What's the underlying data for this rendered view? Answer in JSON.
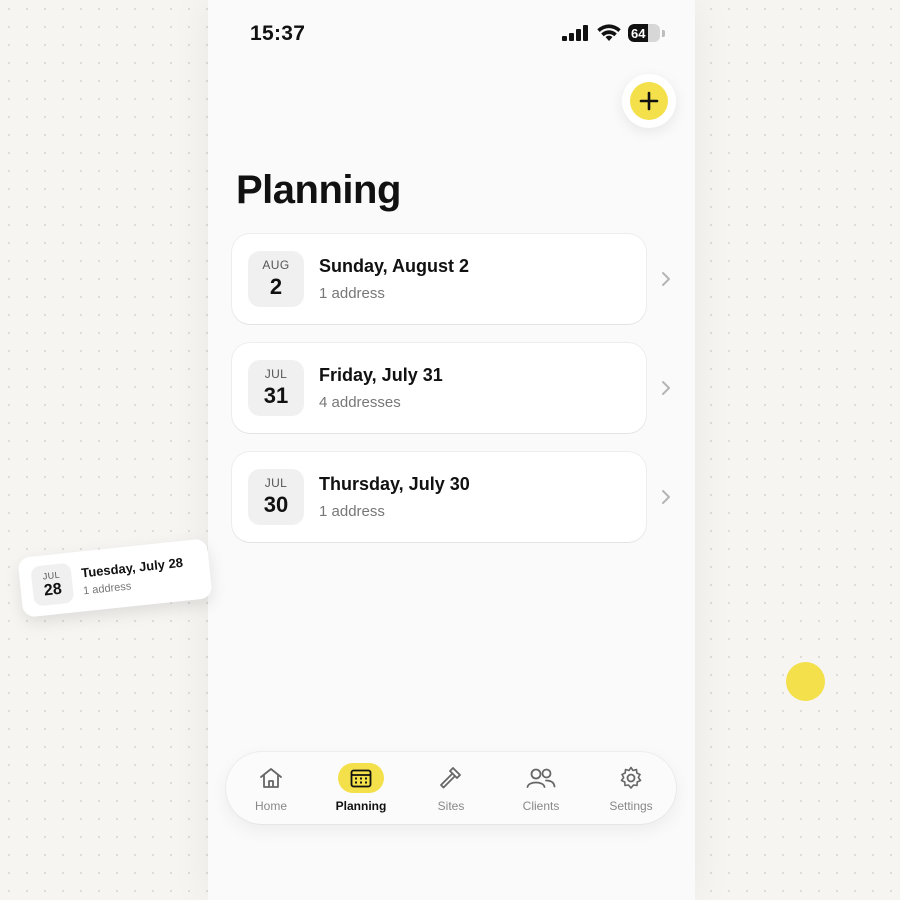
{
  "status_bar": {
    "time": "15:37",
    "battery_percent": 64,
    "battery_label": "64",
    "icons": [
      "cellular-signal-icon",
      "wifi-icon",
      "battery-icon"
    ]
  },
  "header": {
    "title": "Planning",
    "add_icon": "plus-icon"
  },
  "days": [
    {
      "month": "AUG",
      "day": "2",
      "title": "Sunday, August 2",
      "subtitle": "1 address"
    },
    {
      "month": "JUL",
      "day": "31",
      "title": "Friday, July 31",
      "subtitle": "4 addresses"
    },
    {
      "month": "JUL",
      "day": "30",
      "title": "Thursday, July 30",
      "subtitle": "1 address"
    }
  ],
  "floating_card": {
    "month": "JUL",
    "day": "28",
    "title": "Tuesday, July 28",
    "subtitle": "1 address"
  },
  "tabs": [
    {
      "label": "Home",
      "icon": "home-icon",
      "active": false
    },
    {
      "label": "Planning",
      "icon": "calendar-icon",
      "active": true
    },
    {
      "label": "Sites",
      "icon": "hammer-icon",
      "active": false
    },
    {
      "label": "Clients",
      "icon": "users-icon",
      "active": false
    },
    {
      "label": "Settings",
      "icon": "gear-icon",
      "active": false
    }
  ],
  "colors": {
    "accent": "#f3e04a",
    "background": "#fafafa",
    "text": "#111111",
    "muted": "#777777"
  }
}
